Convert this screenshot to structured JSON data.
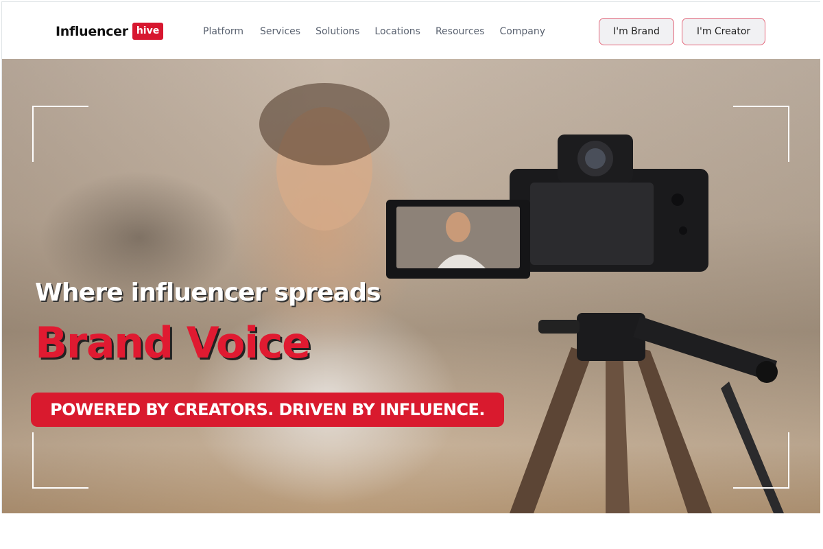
{
  "header": {
    "logo": {
      "text": "Influencer",
      "badge": "hive"
    },
    "nav": [
      "Platform",
      "Services",
      "Solutions",
      "Locations",
      "Resources",
      "Company"
    ],
    "buttons": {
      "brand": "I'm Brand",
      "creator": "I'm Creator"
    }
  },
  "hero": {
    "headline": "Where influencer spreads",
    "highlight": "Brand Voice",
    "tagline": "POWERED BY CREATORS. DRIVEN BY INFLUENCE.",
    "image": "woman-recording-with-camera-on-tripod"
  },
  "colors": {
    "accent": "#d91a2e",
    "button_border": "#e46276",
    "nav_text": "#5a6270"
  }
}
